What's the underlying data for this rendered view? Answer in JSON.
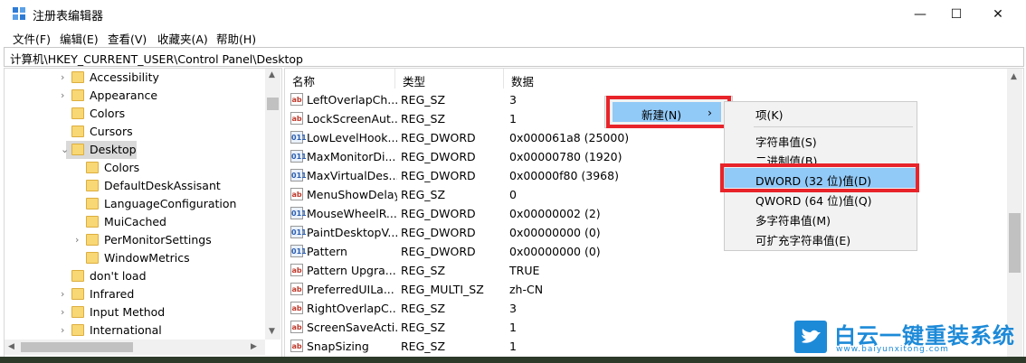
{
  "window": {
    "title": "注册表编辑器",
    "minimize": "—",
    "maximize": "☐",
    "close": "✕"
  },
  "menu": [
    "文件(F)",
    "编辑(E)",
    "查看(V)",
    "收藏夹(A)",
    "帮助(H)"
  ],
  "address": "计算机\\HKEY_CURRENT_USER\\Control Panel\\Desktop",
  "tree": [
    {
      "label": "Accessibility",
      "level": 0,
      "expander": "›"
    },
    {
      "label": "Appearance",
      "level": 0,
      "expander": "›"
    },
    {
      "label": "Colors",
      "level": 0,
      "expander": ""
    },
    {
      "label": "Cursors",
      "level": 0,
      "expander": ""
    },
    {
      "label": "Desktop",
      "level": 0,
      "expander": "⌄",
      "selected": true
    },
    {
      "label": "Colors",
      "level": 1,
      "expander": ""
    },
    {
      "label": "DefaultDeskAssisant",
      "level": 1,
      "expander": ""
    },
    {
      "label": "LanguageConfiguration",
      "level": 1,
      "expander": ""
    },
    {
      "label": "MuiCached",
      "level": 1,
      "expander": ""
    },
    {
      "label": "PerMonitorSettings",
      "level": 1,
      "expander": "›"
    },
    {
      "label": "WindowMetrics",
      "level": 1,
      "expander": ""
    },
    {
      "label": "don't load",
      "level": 0,
      "expander": ""
    },
    {
      "label": "Infrared",
      "level": 0,
      "expander": "›"
    },
    {
      "label": "Input Method",
      "level": 0,
      "expander": "›"
    },
    {
      "label": "International",
      "level": 0,
      "expander": "›"
    }
  ],
  "columns": [
    "名称",
    "类型",
    "数据"
  ],
  "values": [
    {
      "name": "LeftOverlapCh...",
      "type": "REG_SZ",
      "data": "3",
      "icon": "ab"
    },
    {
      "name": "LockScreenAut...",
      "type": "REG_SZ",
      "data": "1",
      "icon": "ab"
    },
    {
      "name": "LowLevelHook...",
      "type": "REG_DWORD",
      "data": "0x000061a8 (25000)",
      "icon": "011"
    },
    {
      "name": "MaxMonitorDi...",
      "type": "REG_DWORD",
      "data": "0x00000780 (1920)",
      "icon": "011"
    },
    {
      "name": "MaxVirtualDes...",
      "type": "REG_DWORD",
      "data": "0x00000f80 (3968)",
      "icon": "011"
    },
    {
      "name": "MenuShowDelay",
      "type": "REG_SZ",
      "data": "0",
      "icon": "ab"
    },
    {
      "name": "MouseWheelR...",
      "type": "REG_DWORD",
      "data": "0x00000002 (2)",
      "icon": "011"
    },
    {
      "name": "PaintDesktopV...",
      "type": "REG_DWORD",
      "data": "0x00000000 (0)",
      "icon": "011"
    },
    {
      "name": "Pattern",
      "type": "REG_DWORD",
      "data": "0x00000000 (0)",
      "icon": "011"
    },
    {
      "name": "Pattern Upgra...",
      "type": "REG_SZ",
      "data": "TRUE",
      "icon": "ab"
    },
    {
      "name": "PreferredUILa...",
      "type": "REG_MULTI_SZ",
      "data": "zh-CN",
      "icon": "ab"
    },
    {
      "name": "RightOverlapC...",
      "type": "REG_SZ",
      "data": "3",
      "icon": "ab"
    },
    {
      "name": "ScreenSaveActi...",
      "type": "REG_SZ",
      "data": "1",
      "icon": "ab"
    },
    {
      "name": "SnapSizing",
      "type": "REG_SZ",
      "data": "1",
      "icon": "ab"
    }
  ],
  "context_menu": {
    "new_label": "新建(N)",
    "arrow": "›"
  },
  "submenu": [
    "项(K)",
    "字符串值(S)",
    "二进制值(B)",
    "DWORD (32 位)值(D)",
    "QWORD (64 位)值(Q)",
    "多字符串值(M)",
    "可扩充字符串值(E)"
  ],
  "watermark": {
    "brand": "白云一键重装系统",
    "url": "www.baiyunxitong.com"
  },
  "colors": {
    "highlight": "#91c9f7",
    "callout": "#e8242a",
    "folder": "#f8d775",
    "brand": "#1d8ad8"
  }
}
